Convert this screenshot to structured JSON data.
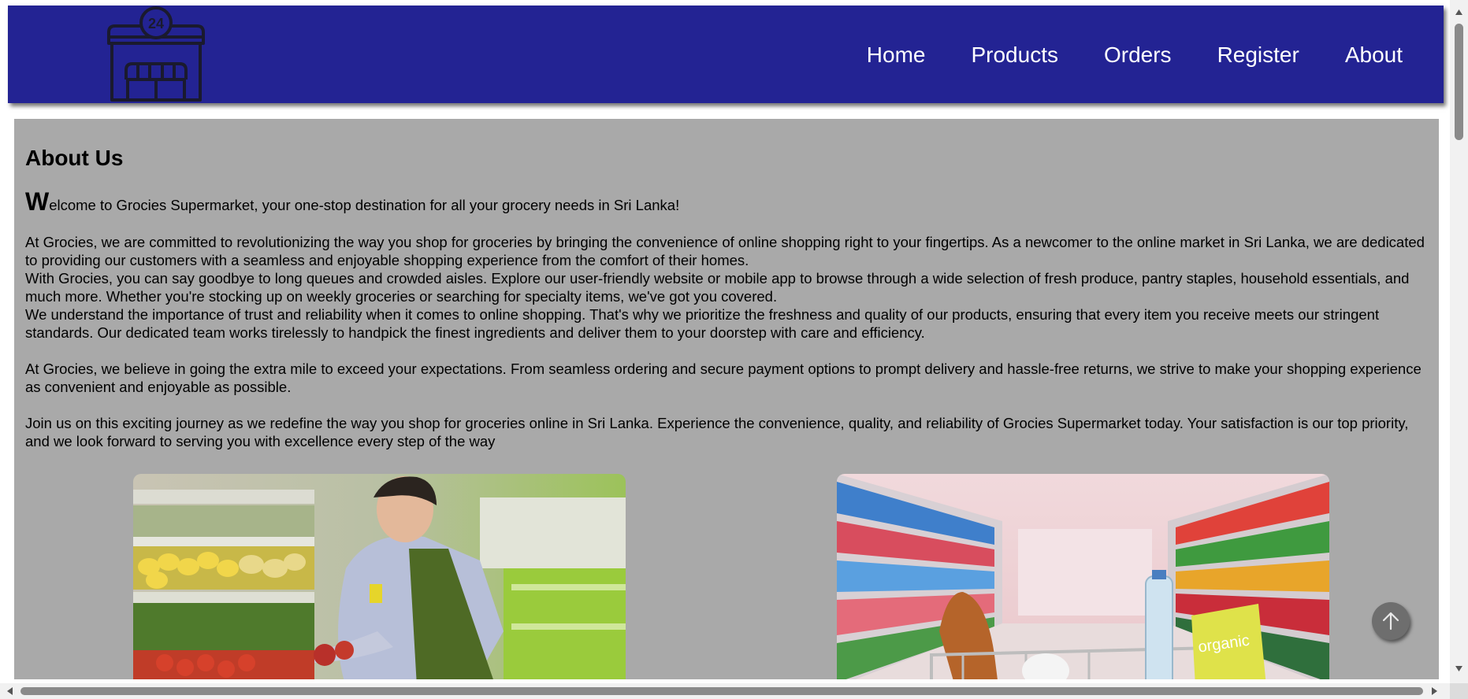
{
  "nav": {
    "logo_badge": "24",
    "links": [
      "Home",
      "Products",
      "Orders",
      "Register",
      "About"
    ]
  },
  "about": {
    "heading": "About Us",
    "welcome_dropcap": "W",
    "welcome_rest": "elcome to Grocies Supermarket, your one-stop destination for all your grocery needs in Sri Lanka!",
    "p1": "At Grocies, we are committed to revolutionizing the way you shop for groceries by bringing the convenience of online shopping right to your fingertips. As a newcomer to the online market in Sri Lanka, we are dedicated to providing our customers with a seamless and enjoyable shopping experience from the comfort of their homes.",
    "p2": "With Grocies, you can say goodbye to long queues and crowded aisles. Explore our user-friendly website or mobile app to browse through a wide selection of fresh produce, pantry staples, household essentials, and much more. Whether you're stocking up on weekly groceries or searching for specialty items, we've got you covered.",
    "p3": "We understand the importance of trust and reliability when it comes to online shopping. That's why we prioritize the freshness and quality of our products, ensuring that every item you receive meets our stringent standards. Our dedicated team works tirelessly to handpick the finest ingredients and deliver them to your doorstep with care and efficiency.",
    "p4": "At Grocies, we believe in going the extra mile to exceed your expectations. From seamless ordering and secure payment options to prompt delivery and hassle-free returns, we strive to make your shopping experience as convenient and enjoyable as possible.",
    "p5": "Join us on this exciting journey as we redefine the way you shop for groceries online in Sri Lanka. Experience the convenience, quality, and reliability of Grocies Supermarket today. Your satisfaction is our top priority, and we look forward to serving you with excellence every step of the way"
  },
  "photo_right_bag_text": "organic",
  "colors": {
    "navbar": "#232393",
    "content_bg": "#a9a9a9",
    "nav_text": "#ffffff"
  }
}
